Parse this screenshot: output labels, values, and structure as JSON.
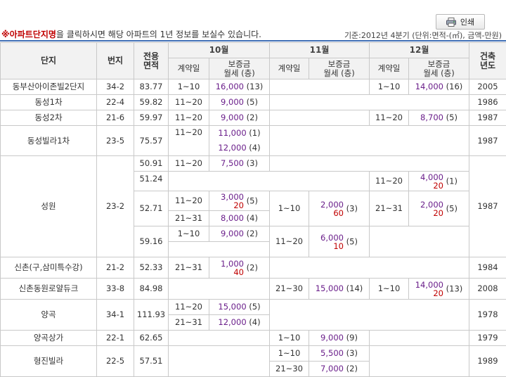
{
  "header": {
    "print_label": "인쇄",
    "notice_mark": "※",
    "notice_highlight": "아파트단지명",
    "notice_rest": "을 클릭하시면 해당 아파트의 1년 정보를 보실수 있습니다.",
    "basis": "기준:2012년 4분기   (단위:면적-(㎡), 금액-만원)"
  },
  "columns": {
    "complex": "단지",
    "lot": "번지",
    "area_line1": "전용",
    "area_line2": "면적",
    "months": [
      "10월",
      "11월",
      "12월"
    ],
    "contract_day": "계약일",
    "deposit_line1": "보증금",
    "deposit_line2": "월세 (층)",
    "build_line1": "건축",
    "build_line2": "년도"
  },
  "rows": {
    "r1": {
      "name": "동부산아이존빌2단지",
      "lot": "34-2",
      "area": "83.77",
      "oct_day": "1~10",
      "oct_amt": "16,000",
      "oct_cnt": "(13)",
      "dec_day": "1~10",
      "dec_amt": "14,000",
      "dec_cnt": "(16)",
      "year": "2005"
    },
    "r2": {
      "name": "동성1차",
      "lot": "22-4",
      "area": "59.82",
      "oct_day": "11~20",
      "oct_amt": "9,000",
      "oct_cnt": "(5)",
      "year": "1986"
    },
    "r3": {
      "name": "동성2차",
      "lot": "21-6",
      "area": "59.97",
      "oct_day": "11~20",
      "oct_amt": "9,000",
      "oct_cnt": "(2)",
      "dec_day": "11~20",
      "dec_amt": "8,700",
      "dec_cnt": "(5)",
      "year": "1987"
    },
    "r4": {
      "name": "동성빌라1차",
      "lot": "23-5",
      "area": "75.57",
      "oct_day": "11~20",
      "oct_amt1": "11,000",
      "oct_cnt1": "(1)",
      "oct_amt2": "12,000",
      "oct_cnt2": "(4)",
      "year": "1987"
    },
    "r5": {
      "name": "성원",
      "lot": "23-2",
      "year": "1987",
      "a1": "50.91",
      "a1_oct_day": "11~20",
      "a1_oct_amt": "7,500",
      "a1_oct_cnt": "(3)",
      "a2": "51.24",
      "a2_dec_day": "11~20",
      "a2_dec_amt": "4,000",
      "a2_dec_rent": "20",
      "a2_dec_cnt": "(1)",
      "a3": "52.71",
      "a3_oct_day1": "11~20",
      "a3_oct_amt1": "3,000",
      "a3_oct_rent1": "20",
      "a3_oct_cnt1": "(5)",
      "a3_oct_day2": "21~31",
      "a3_oct_amt2": "8,000",
      "a3_oct_cnt2": "(4)",
      "a3_nov_day": "1~10",
      "a3_nov_amt": "2,000",
      "a3_nov_rent": "60",
      "a3_nov_cnt": "(3)",
      "a3_dec_day": "21~31",
      "a3_dec_amt": "2,000",
      "a3_dec_rent": "20",
      "a3_dec_cnt": "(5)",
      "a4": "59.16",
      "a4_oct_day": "1~10",
      "a4_oct_amt": "9,000",
      "a4_oct_cnt": "(2)",
      "a4_nov_day": "11~20",
      "a4_nov_amt": "6,000",
      "a4_nov_rent": "10",
      "a4_nov_cnt": "(5)"
    },
    "r6": {
      "name": "신촌(구,삼미특수강)",
      "lot": "21-2",
      "area": "52.33",
      "oct_day": "21~31",
      "oct_amt": "1,000",
      "oct_rent": "40",
      "oct_cnt": "(2)",
      "year": "1984"
    },
    "r7": {
      "name": "신촌동원로얄듀크",
      "lot": "33-8",
      "area": "84.98",
      "nov_day": "21~30",
      "nov_amt": "15,000",
      "nov_cnt": "(14)",
      "dec_day": "1~10",
      "dec_amt": "14,000",
      "dec_rent": "20",
      "dec_cnt": "(13)",
      "year": "2008"
    },
    "r8": {
      "name": "양곡",
      "lot": "34-1",
      "area": "111.93",
      "oct_day1": "11~20",
      "oct_amt1": "15,000",
      "oct_cnt1": "(5)",
      "oct_day2": "21~31",
      "oct_amt2": "12,000",
      "oct_cnt2": "(4)",
      "year": "1978"
    },
    "r9": {
      "name": "양곡상가",
      "lot": "22-1",
      "area": "62.65",
      "nov_day": "1~10",
      "nov_amt": "9,000",
      "nov_cnt": "(9)",
      "year": "1979"
    },
    "r10": {
      "name": "형진빌라",
      "lot": "22-5",
      "area": "57.51",
      "nov_day1": "1~10",
      "nov_amt1": "5,500",
      "nov_cnt1": "(3)",
      "nov_day2": "21~30",
      "nov_amt2": "7,000",
      "nov_cnt2": "(2)",
      "year": "1989"
    }
  }
}
